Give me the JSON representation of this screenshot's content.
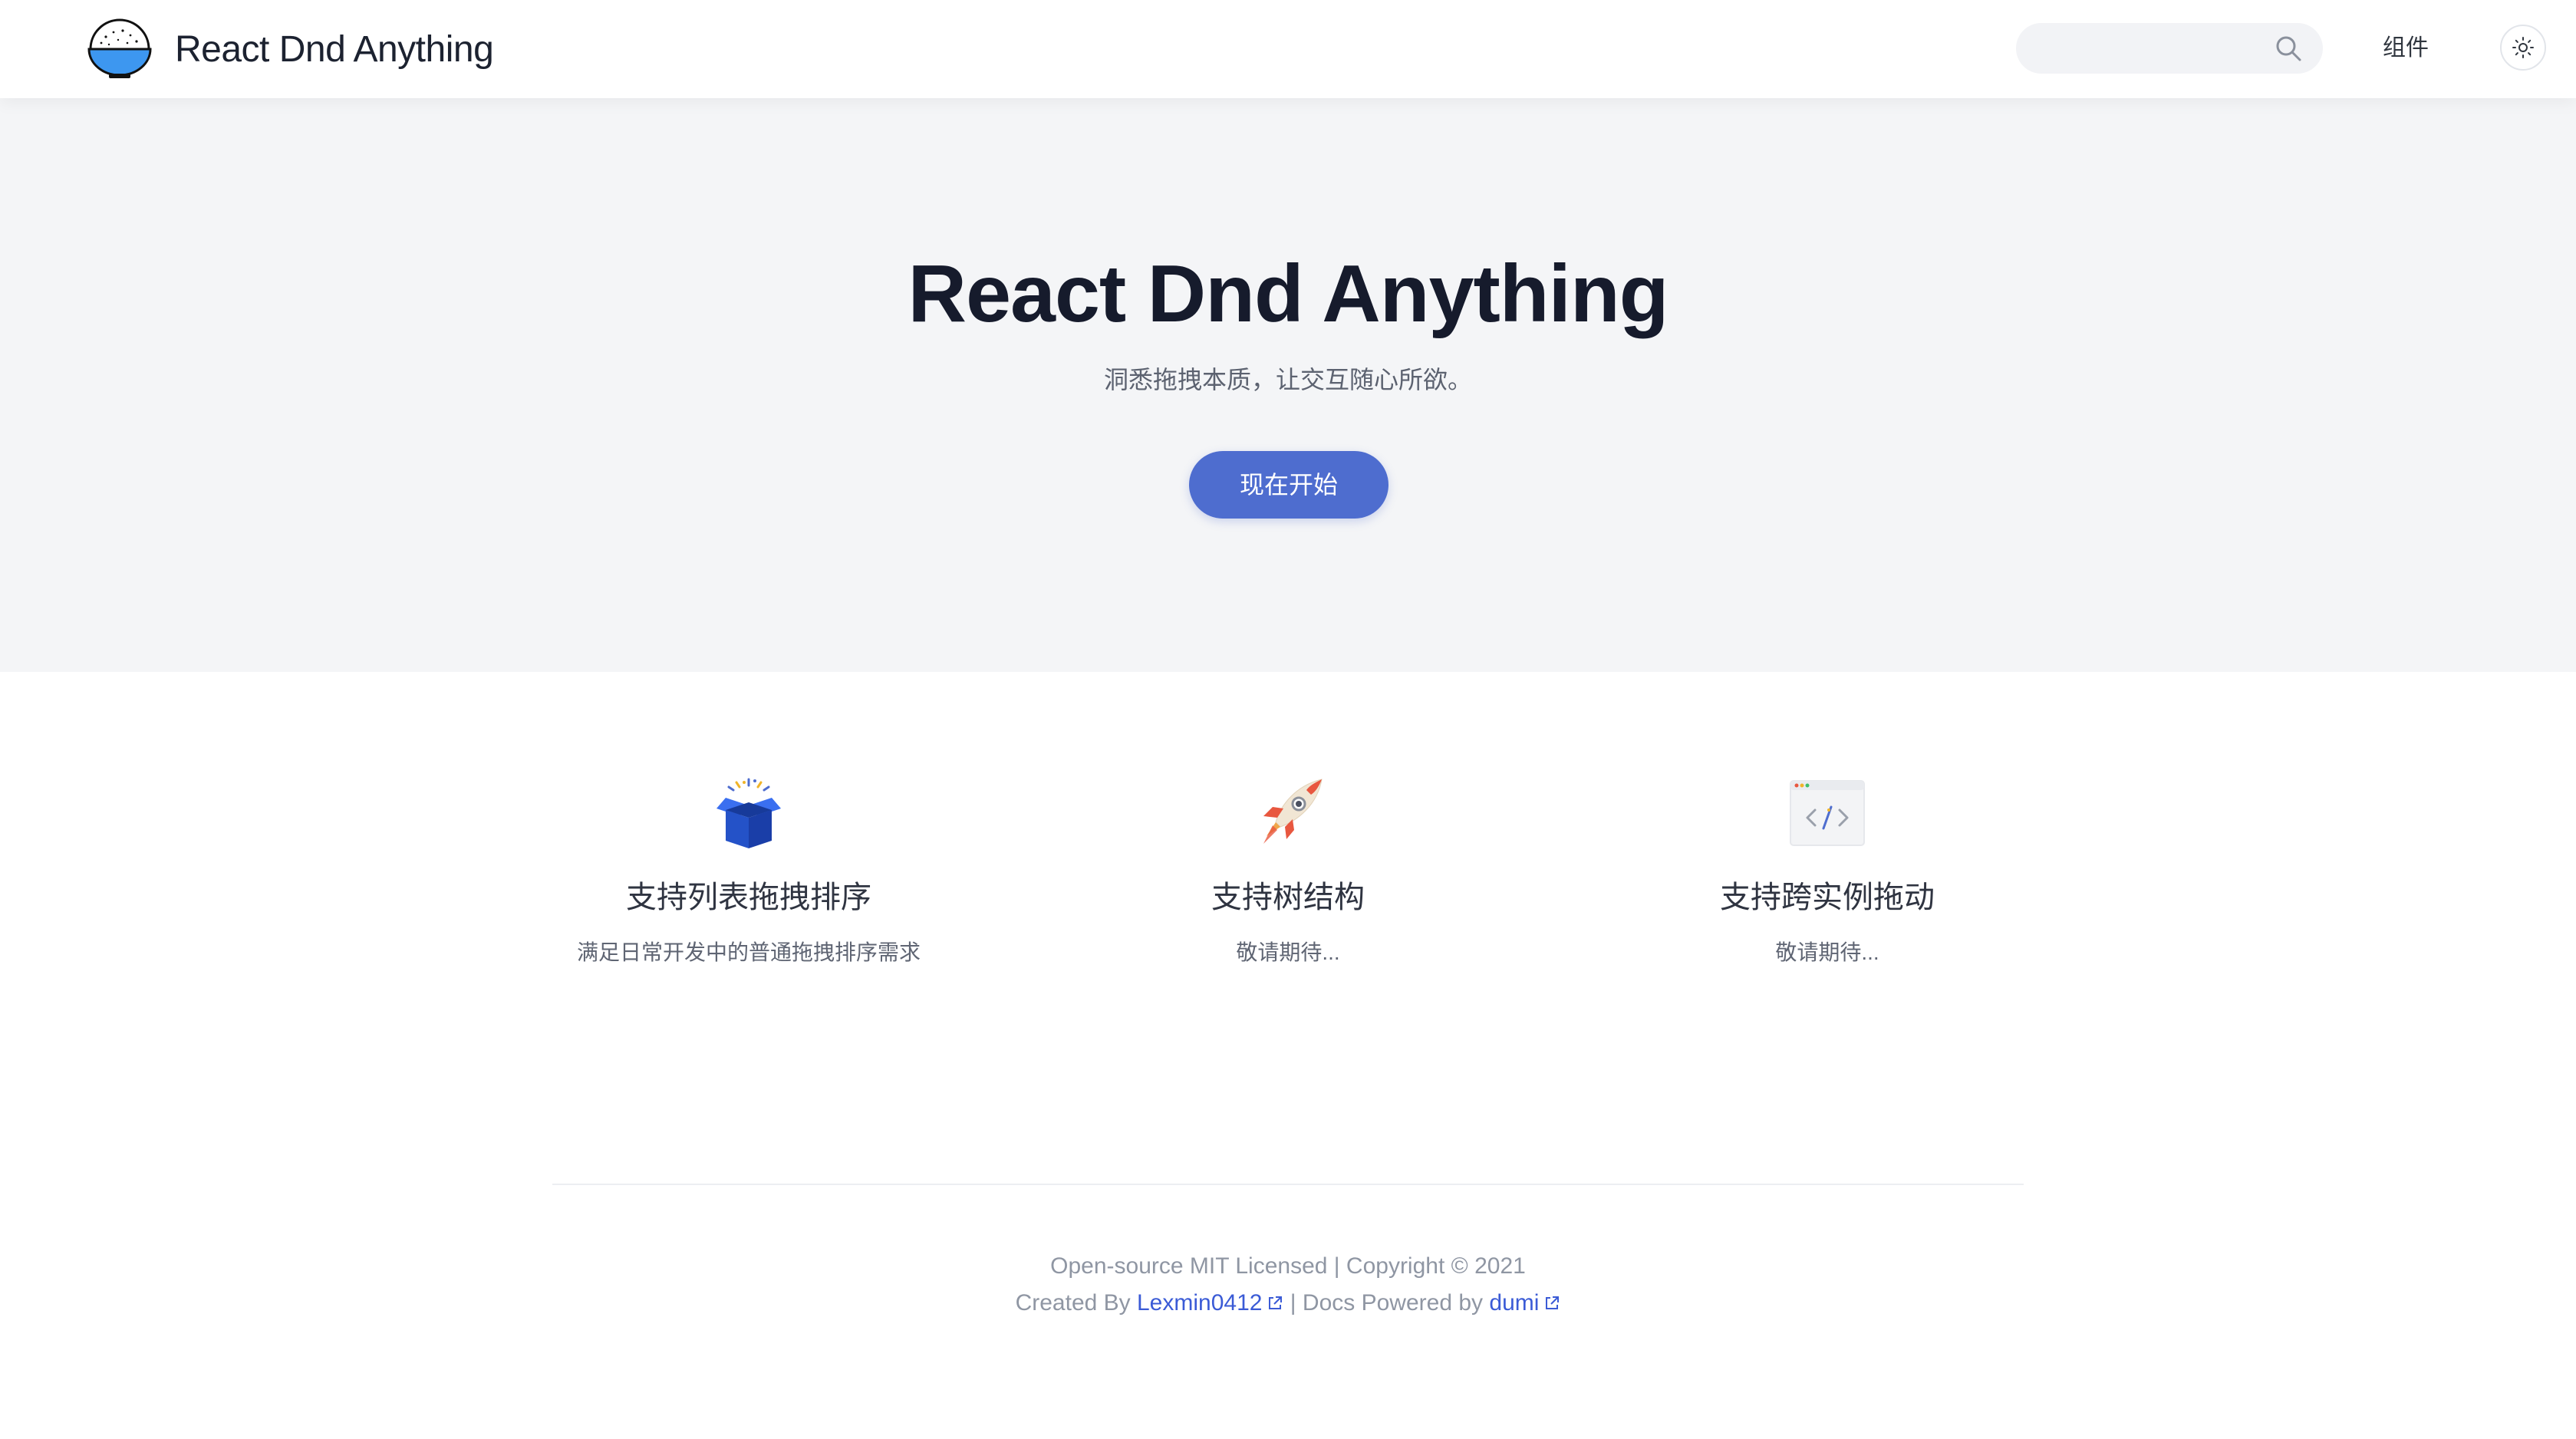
{
  "header": {
    "brand": "React Dnd Anything",
    "logo_icon": "rice-bowl-logo-icon",
    "search": {
      "placeholder": "",
      "value": "",
      "icon": "search-icon"
    },
    "nav": [
      {
        "label": "组件"
      }
    ],
    "theme_toggle_icon": "sun-icon"
  },
  "hero": {
    "title": "React Dnd Anything",
    "description": "洞悉拖拽本质，让交互随心所欲。",
    "cta_label": "现在开始"
  },
  "features": [
    {
      "icon": "open-box-icon",
      "title": "支持列表拖拽排序",
      "description": "满足日常开发中的普通拖拽排序需求"
    },
    {
      "icon": "rocket-icon",
      "title": "支持树结构",
      "description": "敬请期待..."
    },
    {
      "icon": "code-window-icon",
      "title": "支持跨实例拖动",
      "description": "敬请期待..."
    }
  ],
  "footer": {
    "line1": "Open-source MIT Licensed | Copyright © 2021",
    "created_by_prefix": "Created By",
    "author_link": "Lexmin0412",
    "docs_prefix": "| Docs Powered by",
    "docs_link": "dumi",
    "external_link_icon": "external-link-icon"
  },
  "colors": {
    "accent": "#4e6dcf",
    "link": "#3b5bd6",
    "hero_bg": "#f4f5f7",
    "title": "#161b2c"
  }
}
